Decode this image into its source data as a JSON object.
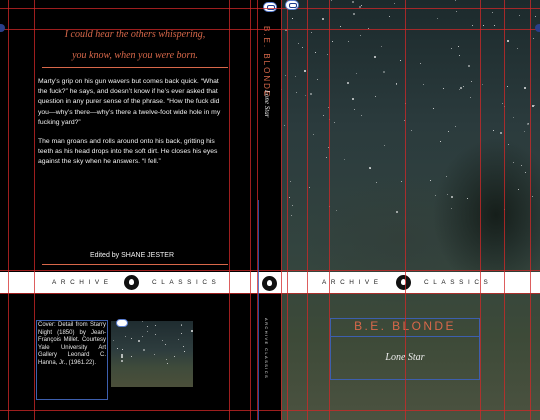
{
  "back_cover": {
    "epigraph": [
      "I could hear the others whispering,",
      "you know, when you were born."
    ],
    "paragraphs": [
      "Marty’s grip on his gun wavers but comes back quick. “What the fuck?” he says, and doesn’t know if he’s ever asked that question in any purer sense of the phrase. “How the fuck did you—why’s there—why’s there a twelve-foot wide hole in my fucking yard?”",
      "The man groans and rolls around onto his back, gritting his teeth as his head drops into the soft dirt. He closes his eyes against the sky when he answers. “I fell.”"
    ],
    "editor": "Edited by SHANE JESTER"
  },
  "band": {
    "left_word_1": "ARCHIVE",
    "left_word_2": "CLASSICS",
    "right_word_1": "ARCHIVE",
    "right_word_2": "CLASSICS"
  },
  "spine": {
    "author": "B.E. BLONDE",
    "title": "Lone Star",
    "imprint": "ARCHIVE CLASSICS"
  },
  "front_cover": {
    "author": "B.E. BLONDE",
    "title": "Lone Star"
  },
  "credit": "Cover: Detail from Starry Night (1850) by Jean-François Millet. Courtesy Yale University Art Gallery Leonard C. Hanna, Jr., (1961.22).",
  "colors": {
    "accent": "#d8684a",
    "guide": "#d22828",
    "frame": "#3d5fae"
  }
}
